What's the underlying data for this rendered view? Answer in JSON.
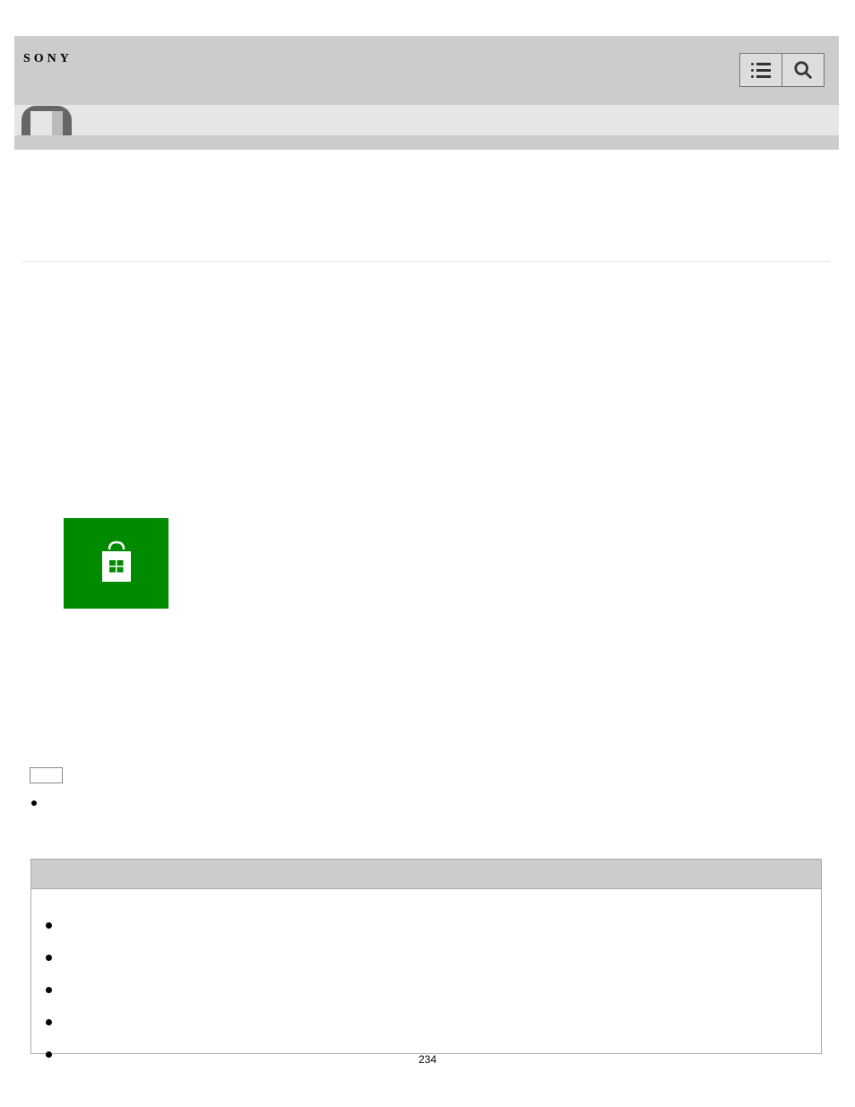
{
  "header": {
    "brand": "SONY"
  },
  "page": {
    "number": "234"
  },
  "table": {
    "rows": [
      "",
      "",
      "",
      "",
      ""
    ]
  }
}
